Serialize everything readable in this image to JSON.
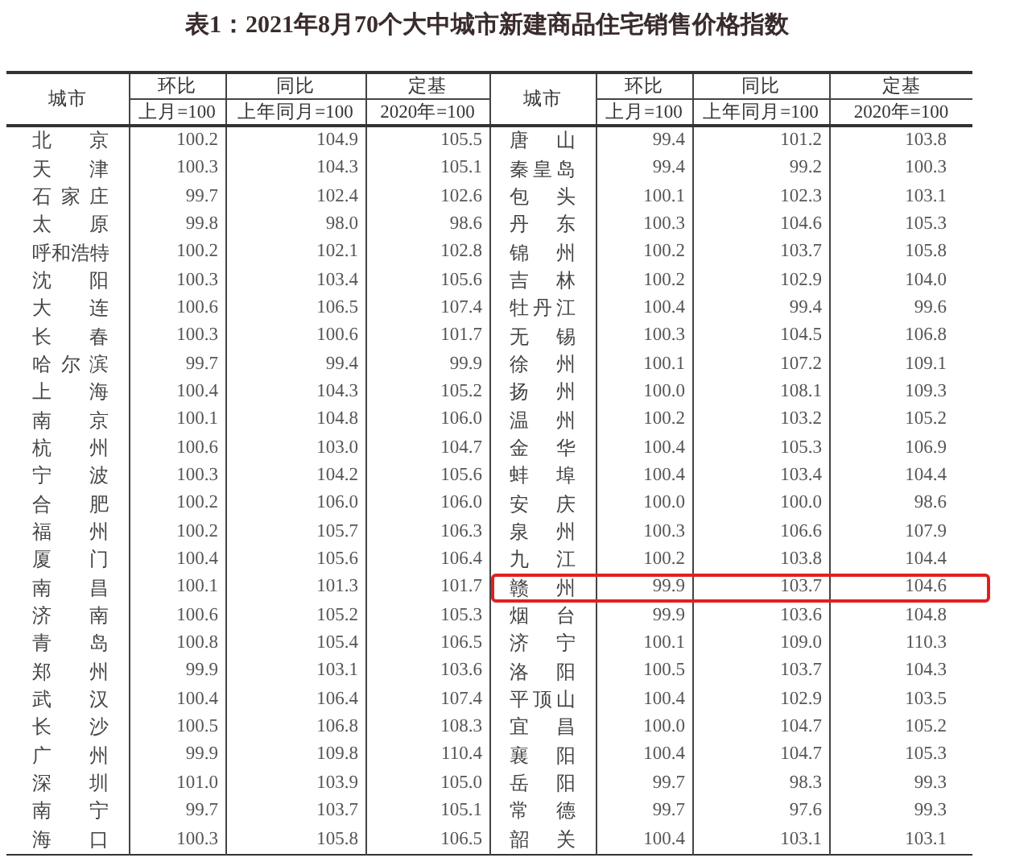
{
  "title": "表1：2021年8月70个大中城市新建商品住宅销售价格指数",
  "columns": {
    "city": "城市",
    "groups": [
      {
        "label": "环比",
        "base": "上月=100"
      },
      {
        "label": "同比",
        "base": "上年同月=100"
      },
      {
        "label": "定基",
        "base": "2020年=100"
      }
    ]
  },
  "right_columns": {
    "city": "城市",
    "groups": [
      {
        "label": "环比",
        "base": "上月=100"
      },
      {
        "label": "同比",
        "base": "上年同月=100"
      },
      {
        "label": "定基",
        "base": "2020年=100"
      }
    ]
  },
  "left_rows": [
    {
      "city": "北京",
      "values": [
        "100.2",
        "104.9",
        "105.5"
      ]
    },
    {
      "city": "天津",
      "values": [
        "100.3",
        "104.3",
        "105.1"
      ]
    },
    {
      "city": "石家庄",
      "values": [
        "99.7",
        "102.4",
        "102.6"
      ]
    },
    {
      "city": "太原",
      "values": [
        "99.8",
        "98.0",
        "98.6"
      ]
    },
    {
      "city": "呼和浩特",
      "values": [
        "100.2",
        "102.1",
        "102.8"
      ]
    },
    {
      "city": "沈阳",
      "values": [
        "100.3",
        "103.4",
        "105.6"
      ]
    },
    {
      "city": "大连",
      "values": [
        "100.6",
        "106.5",
        "107.4"
      ]
    },
    {
      "city": "长春",
      "values": [
        "100.3",
        "100.6",
        "101.7"
      ]
    },
    {
      "city": "哈尔滨",
      "values": [
        "99.7",
        "99.4",
        "99.9"
      ]
    },
    {
      "city": "上海",
      "values": [
        "100.4",
        "104.3",
        "105.2"
      ]
    },
    {
      "city": "南京",
      "values": [
        "100.1",
        "104.8",
        "106.0"
      ]
    },
    {
      "city": "杭州",
      "values": [
        "100.6",
        "103.0",
        "104.7"
      ]
    },
    {
      "city": "宁波",
      "values": [
        "100.3",
        "104.2",
        "105.6"
      ]
    },
    {
      "city": "合肥",
      "values": [
        "100.2",
        "106.0",
        "106.0"
      ]
    },
    {
      "city": "福州",
      "values": [
        "100.2",
        "105.7",
        "106.3"
      ]
    },
    {
      "city": "厦门",
      "values": [
        "100.4",
        "105.6",
        "106.4"
      ]
    },
    {
      "city": "南昌",
      "values": [
        "100.1",
        "101.3",
        "101.7"
      ]
    },
    {
      "city": "济南",
      "values": [
        "100.6",
        "105.2",
        "105.3"
      ]
    },
    {
      "city": "青岛",
      "values": [
        "100.8",
        "105.4",
        "106.5"
      ]
    },
    {
      "city": "郑州",
      "values": [
        "99.9",
        "103.1",
        "103.6"
      ]
    },
    {
      "city": "武汉",
      "values": [
        "100.4",
        "106.4",
        "107.4"
      ]
    },
    {
      "city": "长沙",
      "values": [
        "100.5",
        "106.8",
        "108.3"
      ]
    },
    {
      "city": "广州",
      "values": [
        "99.9",
        "109.8",
        "110.4"
      ]
    },
    {
      "city": "深圳",
      "values": [
        "101.0",
        "103.9",
        "105.0"
      ]
    },
    {
      "city": "南宁",
      "values": [
        "99.7",
        "103.7",
        "105.1"
      ]
    },
    {
      "city": "海口",
      "values": [
        "100.3",
        "105.8",
        "106.5"
      ]
    }
  ],
  "right_rows": [
    {
      "city": "唐山",
      "values": [
        "99.4",
        "101.2",
        "103.8"
      ],
      "highlighted": false
    },
    {
      "city": "秦皇岛",
      "values": [
        "99.4",
        "99.2",
        "100.3"
      ],
      "highlighted": false
    },
    {
      "city": "包头",
      "values": [
        "100.1",
        "102.3",
        "103.1"
      ],
      "highlighted": false
    },
    {
      "city": "丹东",
      "values": [
        "100.3",
        "104.6",
        "105.3"
      ],
      "highlighted": false
    },
    {
      "city": "锦州",
      "values": [
        "100.2",
        "103.7",
        "105.8"
      ],
      "highlighted": false
    },
    {
      "city": "吉林",
      "values": [
        "100.2",
        "102.9",
        "104.0"
      ],
      "highlighted": false
    },
    {
      "city": "牡丹江",
      "values": [
        "100.4",
        "99.4",
        "99.6"
      ],
      "highlighted": false
    },
    {
      "city": "无锡",
      "values": [
        "100.3",
        "104.5",
        "106.8"
      ],
      "highlighted": false
    },
    {
      "city": "徐州",
      "values": [
        "100.1",
        "107.2",
        "109.1"
      ],
      "highlighted": false
    },
    {
      "city": "扬州",
      "values": [
        "100.0",
        "108.1",
        "109.3"
      ],
      "highlighted": false
    },
    {
      "city": "温州",
      "values": [
        "100.2",
        "103.2",
        "105.2"
      ],
      "highlighted": false
    },
    {
      "city": "金华",
      "values": [
        "100.4",
        "105.3",
        "106.9"
      ],
      "highlighted": false
    },
    {
      "city": "蚌埠",
      "values": [
        "100.4",
        "103.4",
        "104.4"
      ],
      "highlighted": false
    },
    {
      "city": "安庆",
      "values": [
        "100.0",
        "100.0",
        "98.6"
      ],
      "highlighted": false
    },
    {
      "city": "泉州",
      "values": [
        "100.3",
        "106.6",
        "107.9"
      ],
      "highlighted": false
    },
    {
      "city": "九江",
      "values": [
        "100.2",
        "103.8",
        "104.4"
      ],
      "highlighted": false
    },
    {
      "city": "赣州",
      "values": [
        "99.9",
        "103.7",
        "104.6"
      ],
      "highlighted": true
    },
    {
      "city": "烟台",
      "values": [
        "99.9",
        "103.6",
        "104.8"
      ],
      "highlighted": false
    },
    {
      "city": "济宁",
      "values": [
        "100.1",
        "109.0",
        "110.3"
      ],
      "highlighted": false
    },
    {
      "city": "洛阳",
      "values": [
        "100.5",
        "103.7",
        "104.3"
      ],
      "highlighted": false
    },
    {
      "city": "平顶山",
      "values": [
        "100.4",
        "102.9",
        "103.5"
      ],
      "highlighted": false
    },
    {
      "city": "宜昌",
      "values": [
        "100.0",
        "104.7",
        "105.2"
      ],
      "highlighted": false
    },
    {
      "city": "襄阳",
      "values": [
        "100.4",
        "104.7",
        "105.3"
      ],
      "highlighted": false
    },
    {
      "city": "岳阳",
      "values": [
        "99.7",
        "98.3",
        "99.3"
      ],
      "highlighted": false
    },
    {
      "city": "常德",
      "values": [
        "99.7",
        "97.6",
        "99.3"
      ],
      "highlighted": false
    },
    {
      "city": "韶关",
      "values": [
        "100.4",
        "103.1",
        "103.1"
      ],
      "highlighted": false
    }
  ]
}
